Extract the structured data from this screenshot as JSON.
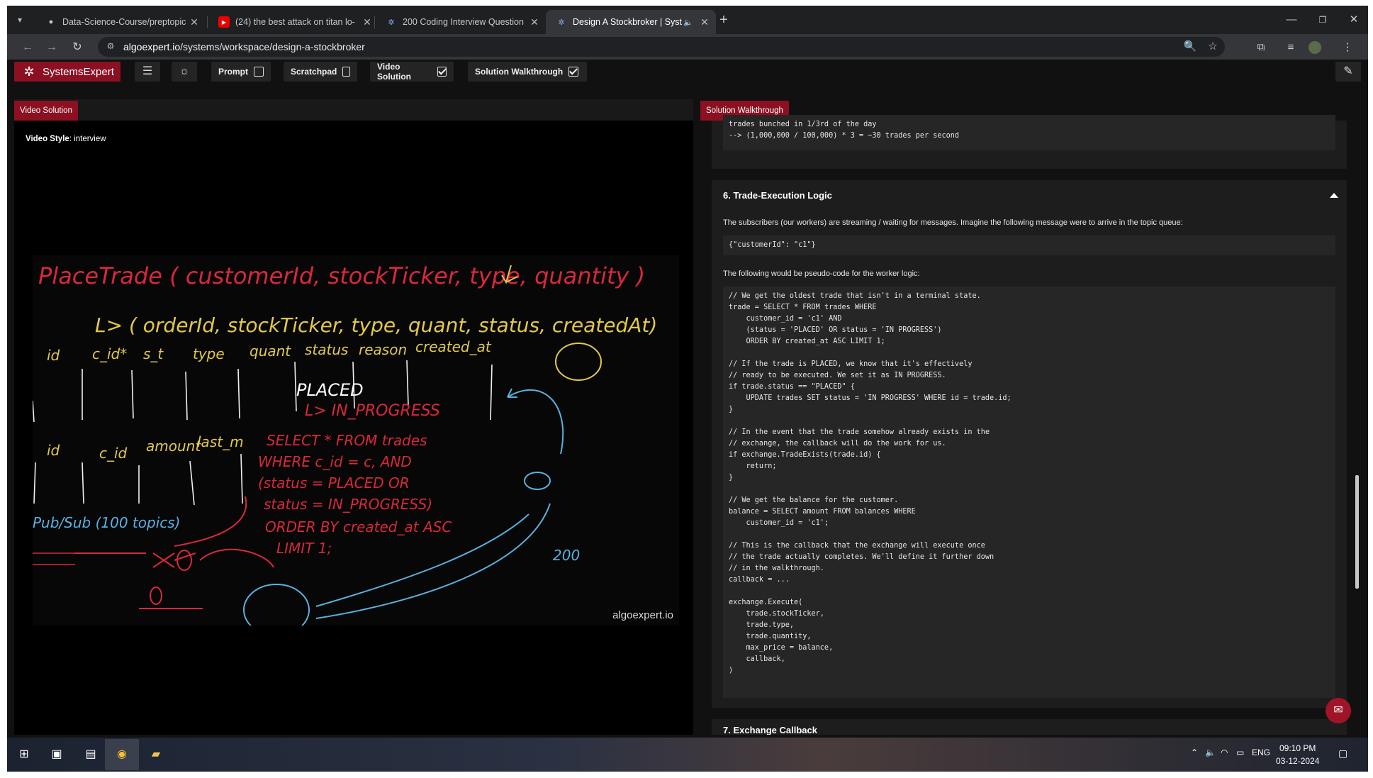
{
  "browser": {
    "tabs": [
      {
        "title": "Data-Science-Course/preptopic",
        "favicon": "github-icon"
      },
      {
        "title": "(24) the best attack on titan lo-",
        "favicon": "youtube-icon"
      },
      {
        "title": "200 Coding Interview Question",
        "favicon": "algoexpert-icon"
      },
      {
        "title": "Design A Stockbroker | Syst",
        "favicon": "algoexpert-icon",
        "audio": "speaker-icon"
      }
    ],
    "url_host": "algoexpert.io",
    "url_path": "/systems/workspace/design-a-stockbroker"
  },
  "app": {
    "brand": "SystemsExpert",
    "toggles": [
      {
        "label": "Prompt",
        "checked": false
      },
      {
        "label": "Scratchpad",
        "checked": false
      },
      {
        "label": "Video Solution",
        "checked": true
      },
      {
        "label": "Solution Walkthrough",
        "checked": true
      }
    ],
    "accent": "#8b1021"
  },
  "video_panel": {
    "tag": "Video Solution",
    "style_label": "Video Style",
    "style_value": "interview",
    "watermark": "algoexpert.io",
    "whiteboard": {
      "l1": "PlaceTrade ( customerId, stockTicker, type, quantity )",
      "l2": "L> ( orderId, stockTicker, type, quant, status, createdAt)",
      "cols1": [
        "id",
        "c_id*",
        "s_t",
        "type",
        "quant",
        "status",
        "reason",
        "created_at"
      ],
      "placed": "PLACED",
      "inprog": "L> IN_PROGRESS",
      "cols2": [
        "id",
        "c_id",
        "amount",
        "last_m"
      ],
      "sql": [
        "SELECT * FROM trades",
        "WHERE c_id = c, AND",
        "(status = PLACED OR",
        "status = IN_PROGRESS)",
        "ORDER BY created_at ASC",
        "LIMIT 1;"
      ],
      "pubsub": "Pub/Sub (100 topics)",
      "n200": "200"
    }
  },
  "walkthrough": {
    "tag": "Solution Walkthrough",
    "prev_code": "trades bunched in 1/3rd of the day\n--> (1,000,000 / 100,000) * 3 = ~30 trades per second",
    "section6": {
      "title": "6. Trade-Execution Logic",
      "p1": "The subscribers (our workers) are streaming / waiting for messages. Imagine the following message were to arrive in the topic queue:",
      "msg": "{\"customerId\": \"c1\"}",
      "p2": "The following would be pseudo-code for the worker logic:",
      "code": "// We get the oldest trade that isn't in a terminal state.\ntrade = SELECT * FROM trades WHERE\n    customer_id = 'c1' AND\n    (status = 'PLACED' OR status = 'IN PROGRESS')\n    ORDER BY created_at ASC LIMIT 1;\n\n// If the trade is PLACED, we know that it's effectively\n// ready to be executed. We set it as IN PROGRESS.\nif trade.status == \"PLACED\" {\n    UPDATE trades SET status = 'IN PROGRESS' WHERE id = trade.id;\n}\n\n// In the event that the trade somehow already exists in the\n// exchange, the callback will do the work for us.\nif exchange.TradeExists(trade.id) {\n    return;\n}\n\n// We get the balance for the customer.\nbalance = SELECT amount FROM balances WHERE\n    customer_id = 'c1';\n\n// This is the callback that the exchange will execute once\n// the trade actually completes. We'll define it further down\n// in the walkthrough.\ncallback = ...\n\nexchange.Execute(\n    trade.stockTicker,\n    trade.type,\n    trade.quantity,\n    max_price = balance,\n    callback,\n)"
    },
    "section7_title": "7. Exchange Callback"
  },
  "taskbar": {
    "tray": [
      "ENG"
    ],
    "time": "09:10 PM",
    "date": "03-12-2024"
  }
}
